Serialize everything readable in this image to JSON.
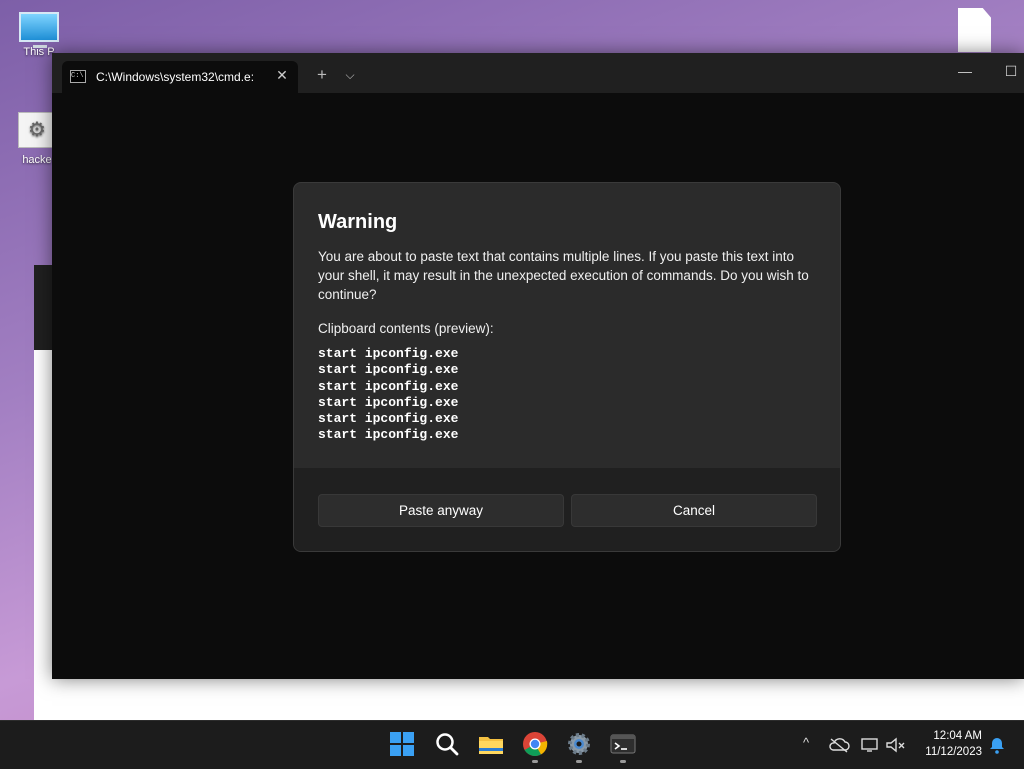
{
  "desktop": {
    "icons": [
      {
        "label": "This P",
        "icon": "this-pc-icon"
      },
      {
        "label": "hacke",
        "icon": "settings-file-icon"
      }
    ]
  },
  "window": {
    "tab_title": "C:\\Windows\\system32\\cmd.e:",
    "tab_icon_text": "C:\\",
    "close_tab": "✕",
    "new_tab": "+",
    "dropdown": "⌵",
    "minimize": "—",
    "maximize": "☐"
  },
  "dialog": {
    "title": "Warning",
    "message": "You are about to paste text that contains multiple lines. If you paste this text into your shell, it may result in the unexpected execution of commands. Do you wish to continue?",
    "clipboard_label": "Clipboard contents (preview):",
    "clipboard_lines": [
      "start ipconfig.exe",
      "start ipconfig.exe",
      "start ipconfig.exe",
      "start ipconfig.exe",
      "start ipconfig.exe",
      "start ipconfig.exe"
    ],
    "paste_button": "Paste anyway",
    "cancel_button": "Cancel"
  },
  "taskbar": {
    "apps": [
      "start-icon",
      "search-icon",
      "file-explorer-icon",
      "chrome-icon",
      "settings-icon",
      "terminal-icon"
    ],
    "tray": {
      "chevron": "^",
      "time": "12:04 AM",
      "date": "11/12/2023"
    }
  },
  "colors": {
    "dialog_bg": "#2b2b2b",
    "terminal_bg": "#0c0c0c",
    "taskbar_bg": "#1c1c1c",
    "accent": "#0078d4"
  }
}
